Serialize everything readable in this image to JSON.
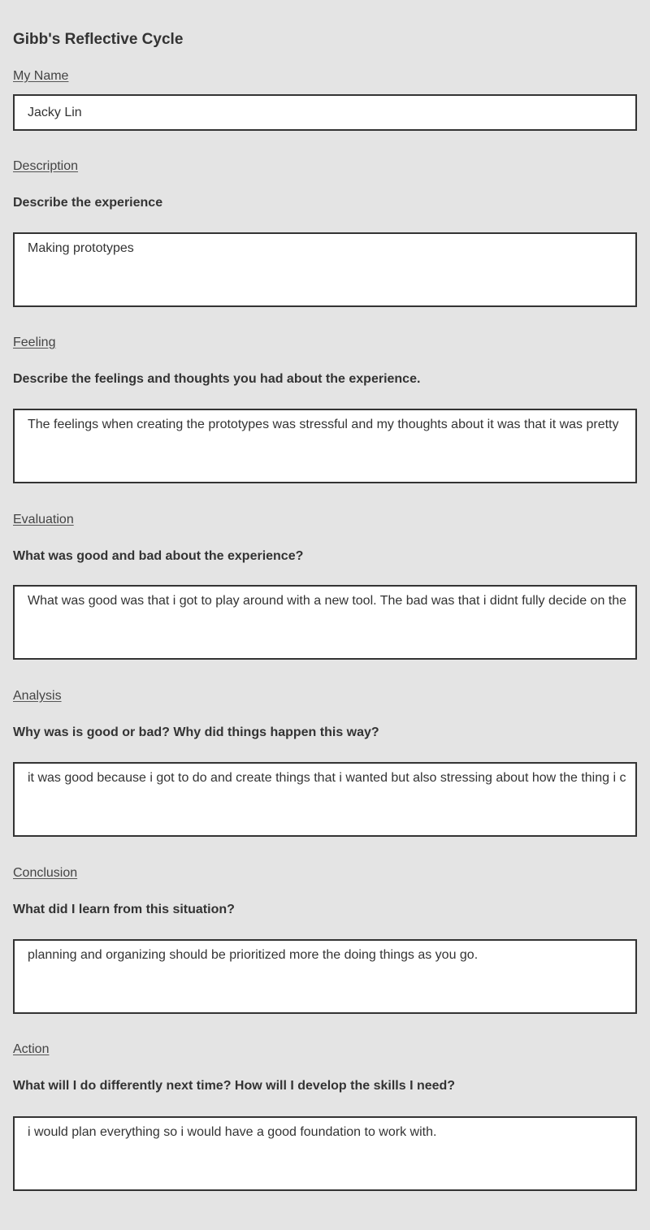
{
  "title": "Gibb's Reflective Cycle",
  "name_section": {
    "label": "My Name",
    "value": "Jacky Lin"
  },
  "sections": [
    {
      "label": "Description",
      "question": "Describe the experience",
      "answer": "Making prototypes"
    },
    {
      "label": "Feeling",
      "question": "Describe the feelings and thoughts you had about the experience.",
      "answer": "The feelings when creating the prototypes was stressful and my thoughts about it was that it was pretty"
    },
    {
      "label": "Evaluation",
      "question": "What was good and bad about the experience?",
      "answer": "What was good was that i got to play around with a new tool. The bad was that i didnt fully decide on the"
    },
    {
      "label": "Analysis",
      "question": "Why was is good or bad? Why did things happen this way?",
      "answer": "it was good because i got to do and create things that i wanted but also stressing about how the thing i c"
    },
    {
      "label": "Conclusion",
      "question": "What did I learn from this situation?",
      "answer": "planning and organizing should be prioritized more the doing things as you go."
    },
    {
      "label": "Action",
      "question": "What will I do differently next time? How will I develop the skills I need?",
      "answer": "i would plan everything so i would have a good foundation to work with."
    }
  ]
}
